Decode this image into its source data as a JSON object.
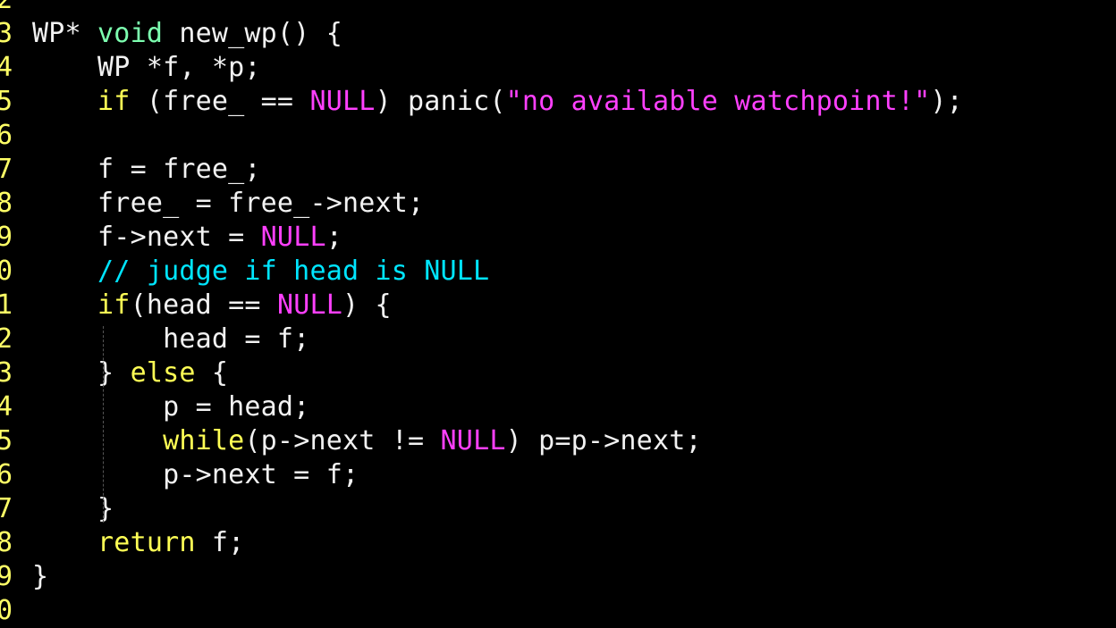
{
  "editor": {
    "colors": {
      "background": "#000000",
      "line_number": "#ffff66",
      "plain": "#f2f2f2",
      "type": "#7dffb0",
      "keyword": "#ffff55",
      "constant": "#ff40ff",
      "string": "#ff40ff",
      "comment": "#00e5ff"
    },
    "lines": [
      {
        "num": "2",
        "tokens": []
      },
      {
        "num": "3",
        "tokens": [
          {
            "t": "WP* ",
            "k": "plain"
          },
          {
            "t": "void",
            "k": "type"
          },
          {
            "t": " new_wp() {",
            "k": "plain"
          }
        ]
      },
      {
        "num": "4",
        "tokens": [
          {
            "t": "    WP *f, *p;",
            "k": "plain"
          }
        ]
      },
      {
        "num": "5",
        "tokens": [
          {
            "t": "    ",
            "k": "plain"
          },
          {
            "t": "if",
            "k": "keyword"
          },
          {
            "t": " (free_ == ",
            "k": "plain"
          },
          {
            "t": "NULL",
            "k": "const"
          },
          {
            "t": ") panic(",
            "k": "plain"
          },
          {
            "t": "\"no available watchpoint!\"",
            "k": "string"
          },
          {
            "t": ");",
            "k": "plain"
          }
        ]
      },
      {
        "num": "6",
        "tokens": []
      },
      {
        "num": "7",
        "tokens": [
          {
            "t": "    f = free_;",
            "k": "plain"
          }
        ]
      },
      {
        "num": "8",
        "tokens": [
          {
            "t": "    free_ = free_->next;",
            "k": "plain"
          }
        ]
      },
      {
        "num": "9",
        "tokens": [
          {
            "t": "    f->next = ",
            "k": "plain"
          },
          {
            "t": "NULL",
            "k": "const"
          },
          {
            "t": ";",
            "k": "plain"
          }
        ]
      },
      {
        "num": "0",
        "tokens": [
          {
            "t": "    ",
            "k": "plain"
          },
          {
            "t": "// judge if head is NULL",
            "k": "comment"
          }
        ]
      },
      {
        "num": "1",
        "tokens": [
          {
            "t": "    ",
            "k": "plain"
          },
          {
            "t": "if",
            "k": "keyword"
          },
          {
            "t": "(head == ",
            "k": "plain"
          },
          {
            "t": "NULL",
            "k": "const"
          },
          {
            "t": ") {",
            "k": "plain"
          }
        ]
      },
      {
        "num": "2",
        "tokens": [
          {
            "t": "        head = f;",
            "k": "plain"
          }
        ]
      },
      {
        "num": "3",
        "tokens": [
          {
            "t": "    } ",
            "k": "plain"
          },
          {
            "t": "else",
            "k": "keyword"
          },
          {
            "t": " {",
            "k": "plain"
          }
        ]
      },
      {
        "num": "4",
        "tokens": [
          {
            "t": "        p = head;",
            "k": "plain"
          }
        ]
      },
      {
        "num": "5",
        "tokens": [
          {
            "t": "        ",
            "k": "plain"
          },
          {
            "t": "while",
            "k": "keyword"
          },
          {
            "t": "(p->next != ",
            "k": "plain"
          },
          {
            "t": "NULL",
            "k": "const"
          },
          {
            "t": ") p=p->next;",
            "k": "plain"
          }
        ]
      },
      {
        "num": "6",
        "tokens": [
          {
            "t": "        p->next = f;",
            "k": "plain"
          }
        ]
      },
      {
        "num": "7",
        "tokens": [
          {
            "t": "    }",
            "k": "plain"
          }
        ]
      },
      {
        "num": "8",
        "tokens": [
          {
            "t": "    ",
            "k": "plain"
          },
          {
            "t": "return",
            "k": "keyword"
          },
          {
            "t": " f;",
            "k": "plain"
          }
        ]
      },
      {
        "num": "9",
        "tokens": [
          {
            "t": "}",
            "k": "plain"
          }
        ]
      },
      {
        "num": "0",
        "tokens": []
      }
    ]
  }
}
